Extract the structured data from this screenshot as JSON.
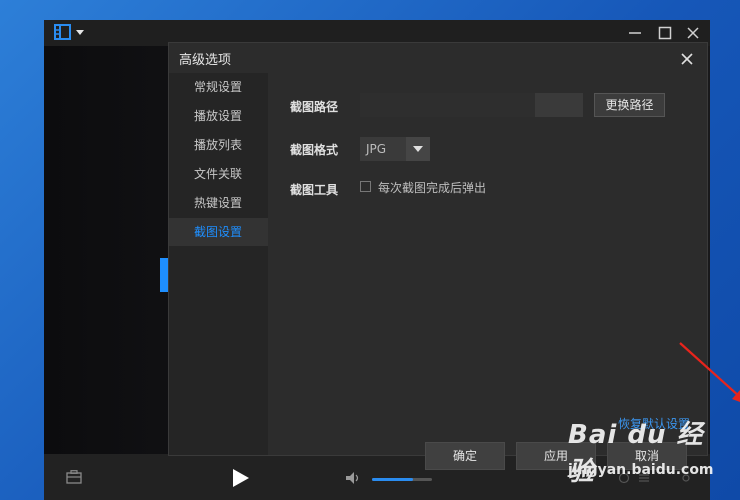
{
  "dialog": {
    "title": "高级选项",
    "nav": [
      {
        "label": "常规设置",
        "active": false
      },
      {
        "label": "播放设置",
        "active": false
      },
      {
        "label": "播放列表",
        "active": false
      },
      {
        "label": "文件关联",
        "active": false
      },
      {
        "label": "热键设置",
        "active": false
      },
      {
        "label": "截图设置",
        "active": true
      }
    ],
    "screenshot": {
      "path_label": "截图路径",
      "change_path_button": "更换路径",
      "format_label": "截图格式",
      "format_value": "JPG",
      "tool_label": "截图工具",
      "popup_checkbox_label": "每次截图完成后弹出",
      "popup_checked": false
    },
    "restore_defaults": "恢复默认设置",
    "buttons": {
      "ok": "确定",
      "apply": "应用",
      "cancel": "取消"
    }
  },
  "player": {
    "volume_level": 0.68
  },
  "watermark": {
    "logo": "Bai du 经验",
    "url": "jingyan.baidu.com"
  },
  "colors": {
    "accent": "#1e8fff",
    "link": "#3b96f0",
    "annotation_arrow": "#e8241c"
  }
}
